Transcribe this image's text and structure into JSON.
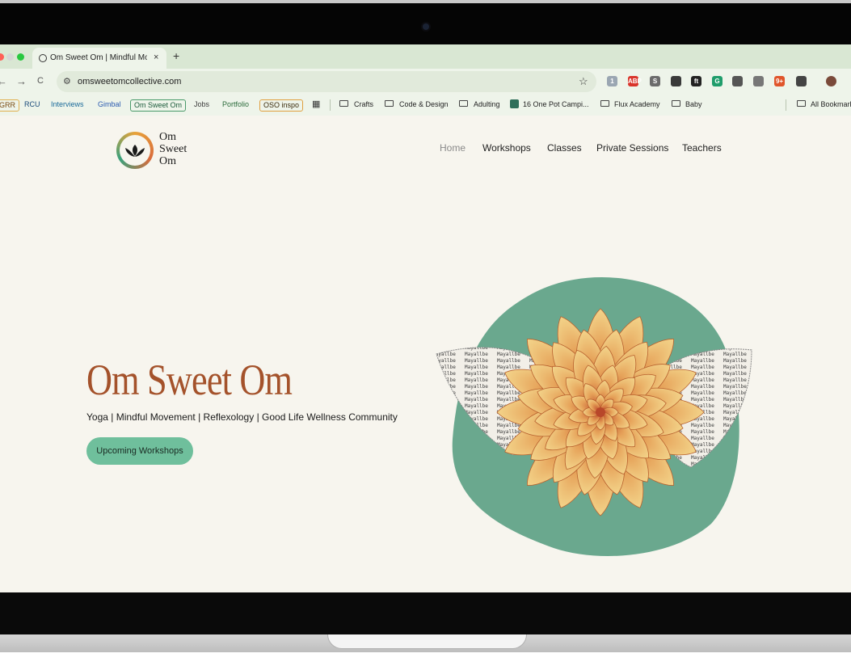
{
  "browser": {
    "tab_title": "Om Sweet Om | Mindful Move",
    "tab_close": "×",
    "new_tab": "+",
    "back": "←",
    "forward": "→",
    "reload": "C",
    "url": "omsweetomcollective.com",
    "site_settings": "⚙",
    "bookmark_star": "☆",
    "extensions": [
      {
        "name": "1",
        "color": "#9aa6b2"
      },
      {
        "name": "ABP",
        "color": "#d9342b"
      },
      {
        "name": "S",
        "color": "#6b6b6b"
      },
      {
        "name": "",
        "color": "#3a3a3a"
      },
      {
        "name": "ft",
        "color": "#222222"
      },
      {
        "name": "G",
        "color": "#1f9d6b"
      },
      {
        "name": "",
        "color": "#555555"
      },
      {
        "name": "",
        "color": "#777777"
      },
      {
        "name": "9+",
        "color": "#e0552b"
      },
      {
        "name": "",
        "color": "#444444"
      },
      {
        "name": "",
        "color": "#7a4a3a"
      }
    ]
  },
  "bookmarks": {
    "items": [
      {
        "label": "GRR",
        "color": "#7a4a10",
        "border": "#e0b050"
      },
      {
        "label": "RCU",
        "color": "#1a4a7a",
        "border": ""
      },
      {
        "label": "Interviews",
        "color": "#1a6a9a",
        "border": ""
      },
      {
        "label": "Gimbal",
        "color": "#2a5ab0",
        "border": ""
      },
      {
        "label": "Om Sweet Om",
        "color": "#1a5a3a",
        "border": "#4a9a6a"
      },
      {
        "label": "Jobs",
        "color": "#3a3a3a",
        "border": ""
      },
      {
        "label": "Portfolio",
        "color": "#2a6a3a",
        "border": ""
      },
      {
        "label": "OSO inspo",
        "color": "#3a2a0a",
        "border": "#e0a040"
      }
    ],
    "folders": [
      "Crafts",
      "Code & Design",
      "Adulting",
      "16 One Pot Campi...",
      "Flux Academy",
      "Baby"
    ],
    "all_bookmarks": "All Bookmarks"
  },
  "site": {
    "logo_text": [
      "Om",
      "Sweet",
      "Om"
    ],
    "nav": [
      "Home",
      "Workshops",
      "Classes",
      "Private Sessions",
      "Teachers"
    ],
    "hero_title": "Om Sweet Om",
    "subtitle": "Yoga | Mindful Movement | Reflexology | Good Life Wellness Community",
    "cta": "Upcoming Workshops",
    "art_text": "Mayallbeingseverywhereb eelshowsoundedinwholesubstance"
  },
  "colors": {
    "accent_title": "#a4522b",
    "cta_bg": "#6fbf9c",
    "blob": "#6aa88e",
    "petal_light": "#f3d48a",
    "petal_dark": "#c4542e"
  }
}
